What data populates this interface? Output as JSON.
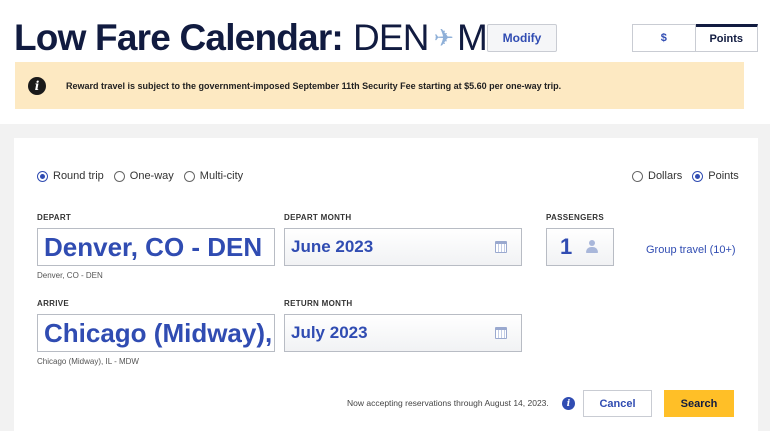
{
  "header": {
    "title_bold": "Low Fare Calendar:",
    "origin": "DEN",
    "destination": "MDW",
    "modify_label": "Modify"
  },
  "currency_toggle": {
    "options": [
      "$",
      "Points"
    ],
    "selected": "Points"
  },
  "notice": {
    "text": "Reward travel is subject to the government-imposed September 11th Security Fee starting at $5.60 per one-way trip."
  },
  "trip_type": {
    "options": [
      "Round trip",
      "One-way",
      "Multi-city"
    ],
    "selected": "Round trip"
  },
  "fare_type": {
    "options": [
      "Dollars",
      "Points"
    ],
    "selected": "Points"
  },
  "form": {
    "depart": {
      "label": "DEPART",
      "value": "Denver, CO - DEN",
      "sub": "Denver, CO - DEN"
    },
    "depart_month": {
      "label": "DEPART MONTH",
      "value": "June 2023"
    },
    "passengers": {
      "label": "PASSENGERS",
      "value": "1"
    },
    "group_travel": "Group travel (10+)",
    "arrive": {
      "label": "ARRIVE",
      "value": "Chicago (Midway), IL - MDW",
      "sub": "Chicago (Midway), IL - MDW"
    },
    "return_month": {
      "label": "RETURN MONTH",
      "value": "July 2023"
    }
  },
  "footer": {
    "accepting_text": "Now accepting reservations through August 14, 2023.",
    "cancel_label": "Cancel",
    "search_label": "Search"
  },
  "colors": {
    "brand_blue": "#304cb2",
    "navy": "#111b40",
    "search_yellow": "#ffbf27",
    "notice_bg": "#fde9c2"
  },
  "icons": [
    "airplane-icon",
    "info-icon",
    "calendar-icon",
    "person-icon"
  ]
}
